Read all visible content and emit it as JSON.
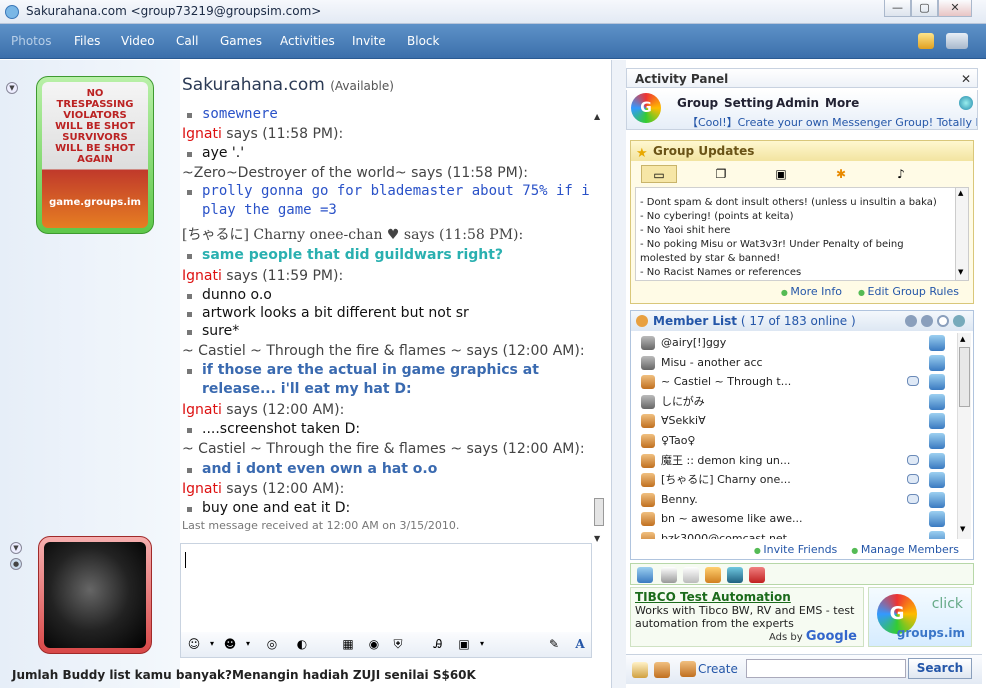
{
  "window": {
    "title": "Sakurahana.com <group73219@groupsim.com>",
    "controls": [
      "—",
      "▢",
      "✕"
    ]
  },
  "menubar": {
    "items": [
      "Photos",
      "Files",
      "Video",
      "Call",
      "Games",
      "Activities",
      "Invite",
      "Block"
    ]
  },
  "contact": {
    "name": "Sakurahana.com",
    "status": "(Available)",
    "avatar_caption": "game.groups.im",
    "avatar_sign": "NO TRESPASSING VIOLATORS WILL BE SHOT SURVIVORS WILL BE SHOT AGAIN"
  },
  "chat": {
    "lines": [
      {
        "kind": "msg",
        "style": "blue",
        "text": "somewnere"
      },
      {
        "kind": "hdr",
        "who": "Ignati",
        "red": true,
        "text": " says (11:58 PM):"
      },
      {
        "kind": "msg",
        "style": "",
        "text": "aye '.'"
      },
      {
        "kind": "hdr",
        "who": "",
        "red": false,
        "text": "~Zero~Destroyer of the world~ says (11:58 PM):"
      },
      {
        "kind": "msg",
        "style": "blue",
        "text": "prolly gonna go for blademaster about 75% if i"
      },
      {
        "kind": "cont",
        "style": "blue",
        "text": "play the game =3"
      },
      {
        "kind": "hdr",
        "who": "",
        "red": false,
        "serif": true,
        "text": "[ちゃるに] Charny onee-chan ♥ says (11:58 PM):"
      },
      {
        "kind": "msg",
        "style": "teal",
        "text": "same people that did guildwars right?"
      },
      {
        "kind": "hdr",
        "who": "Ignati",
        "red": true,
        "text": " says (11:59 PM):"
      },
      {
        "kind": "msg",
        "style": "",
        "text": "dunno o.o"
      },
      {
        "kind": "msg",
        "style": "",
        "text": "artwork looks a bit different but not sr"
      },
      {
        "kind": "msg",
        "style": "",
        "text": "sure*"
      },
      {
        "kind": "hdr",
        "who": "",
        "red": false,
        "text": "~ Castiel ~ Through the fire & flames ~ says (12:00 AM):"
      },
      {
        "kind": "msg",
        "style": "steel",
        "text": "if those are the actual in game graphics at"
      },
      {
        "kind": "cont",
        "style": "steel",
        "text": "release... i'll eat my hat D:"
      },
      {
        "kind": "hdr",
        "who": "Ignati",
        "red": true,
        "text": " says (12:00 AM):"
      },
      {
        "kind": "msg",
        "style": "",
        "text": "....screenshot taken D:"
      },
      {
        "kind": "hdr",
        "who": "",
        "red": false,
        "text": "~ Castiel ~ Through the fire & flames ~ says (12:00 AM):"
      },
      {
        "kind": "msg",
        "style": "steel",
        "text": "and i dont even own a hat o.o"
      },
      {
        "kind": "hdr",
        "who": "Ignati",
        "red": true,
        "text": " says (12:00 AM):"
      },
      {
        "kind": "msg",
        "style": "",
        "text": "buy one and eat it D:"
      }
    ],
    "last_message": "Last message received at 12:00 AM on 3/15/2010."
  },
  "input": {
    "value": ""
  },
  "footer_ad": "Jumlah Buddy list kamu banyak?Menangin hadiah ZUJI senilai S$60K",
  "activity": {
    "title": "Activity Panel",
    "close": "✕",
    "menu": [
      "Group",
      "Setting",
      "Admin",
      "More"
    ],
    "promo": "【Cool!】Create your own Messenger Group! Totally Free",
    "updates_title": "Group Updates",
    "rules": [
      "- Dont spam & dont insult others! (unless u insultin a baka)",
      "- No cybering! (points at keita)",
      "- No Yaoi shit here",
      "- No poking Misu or Wat3v3r! Under Penalty of being molested by star & banned!",
      "- No Racist Names or references"
    ],
    "more_info": "More Info",
    "edit_rules": "Edit Group Rules"
  },
  "members": {
    "title": "Member List",
    "count": "( 17 of 183 online )",
    "list": [
      {
        "name": "@airy[!]ggy",
        "grey": true,
        "chat": false
      },
      {
        "name": "Misu - another acc",
        "grey": true,
        "chat": false
      },
      {
        "name": "~ Castiel ~ Through t...",
        "grey": false,
        "chat": true
      },
      {
        "name": "しにがみ",
        "grey": true,
        "chat": false
      },
      {
        "name": "∀Sekki∀",
        "grey": false,
        "chat": false
      },
      {
        "name": "♀Tao♀",
        "grey": false,
        "chat": false
      },
      {
        "name": "魔王 :: demon king un...",
        "grey": false,
        "chat": true
      },
      {
        "name": "[ちゃるに] Charny one...",
        "grey": false,
        "chat": true
      },
      {
        "name": "Benny.",
        "grey": false,
        "chat": true
      },
      {
        "name": "bn ~ awesome like awe...",
        "grey": false,
        "chat": false
      },
      {
        "name": "bzk3000@comcast.net",
        "grey": false,
        "chat": false
      }
    ],
    "invite": "Invite Friends",
    "manage": "Manage Members"
  },
  "ad": {
    "title": "TIBCO Test Automation",
    "body": "Works with Tibco BW, RV and EMS - test automation from the experts",
    "ads_by": "Ads by",
    "google": "Google",
    "badge_click": "click",
    "badge_text": "groups.im"
  },
  "bottom": {
    "create": "Create",
    "search_placeholder": "",
    "search": "Search"
  },
  "colors": {
    "accent": "#3b6fab",
    "red_name": "#dd1111",
    "blue_msg": "#2a52c8",
    "teal_msg": "#2ab0b0"
  }
}
